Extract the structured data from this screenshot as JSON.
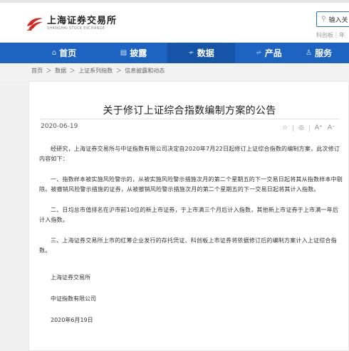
{
  "header": {
    "logo_cn": "上海证券交易所",
    "logo_en": "SHANGHAI STOCK EXCHANGE",
    "search_placeholder": "输入关",
    "sub_text": "科创板｜年"
  },
  "nav": {
    "items": [
      {
        "label": "首页",
        "icon": "home-icon"
      },
      {
        "label": "披露",
        "icon": "disclosure-icon"
      },
      {
        "label": "数据",
        "icon": "data-icon"
      },
      {
        "label": "产品",
        "icon": "product-icon"
      },
      {
        "label": "服务",
        "icon": "service-icon"
      }
    ],
    "active_index": 2
  },
  "breadcrumb": {
    "items": [
      "首页",
      "数据",
      "上证系列指数",
      "信息披露和动态"
    ],
    "separator": "＞"
  },
  "article": {
    "title": "关于修订上证综合指数编制方案的公告",
    "date": "2020-06-19",
    "paragraphs": [
      "经研究，上海证券交易所与中证指数有限公司决定自2020年7月22日起修订上证综合指数的编制方案，此次修订内容如下：",
      "一、指数样本被实施风险警示的，从被实施风险警示措施次月的第二个星期五的下一交易日起将其从指数样本中剔除。被撤销风险警示措施的证券，从被撤销风险警示措施次月的第二个星期五的下一交易日起将其计入指数。",
      "二、日均总市值排名在沪市前10位的新上市证券，于上市满三个月后计入指数，其他新上市证券于上市满一年后计入指数。",
      "三、上海证券交易所上市的红筹企业发行的存托凭证、科创板上市证券将依据修订后的编制方案计入上证综合指数。"
    ],
    "signatures": [
      "上海证券交易所",
      "中证指数有限公司",
      "2020年6月19日"
    ],
    "tools": [
      "☆",
      "◎",
      "A⁺",
      "A⁻"
    ]
  },
  "colors": {
    "nav_bg": "#1d64c2",
    "nav_active": "#1654a8",
    "logo_red": "#d7261e",
    "search_border": "#2a72c9"
  }
}
